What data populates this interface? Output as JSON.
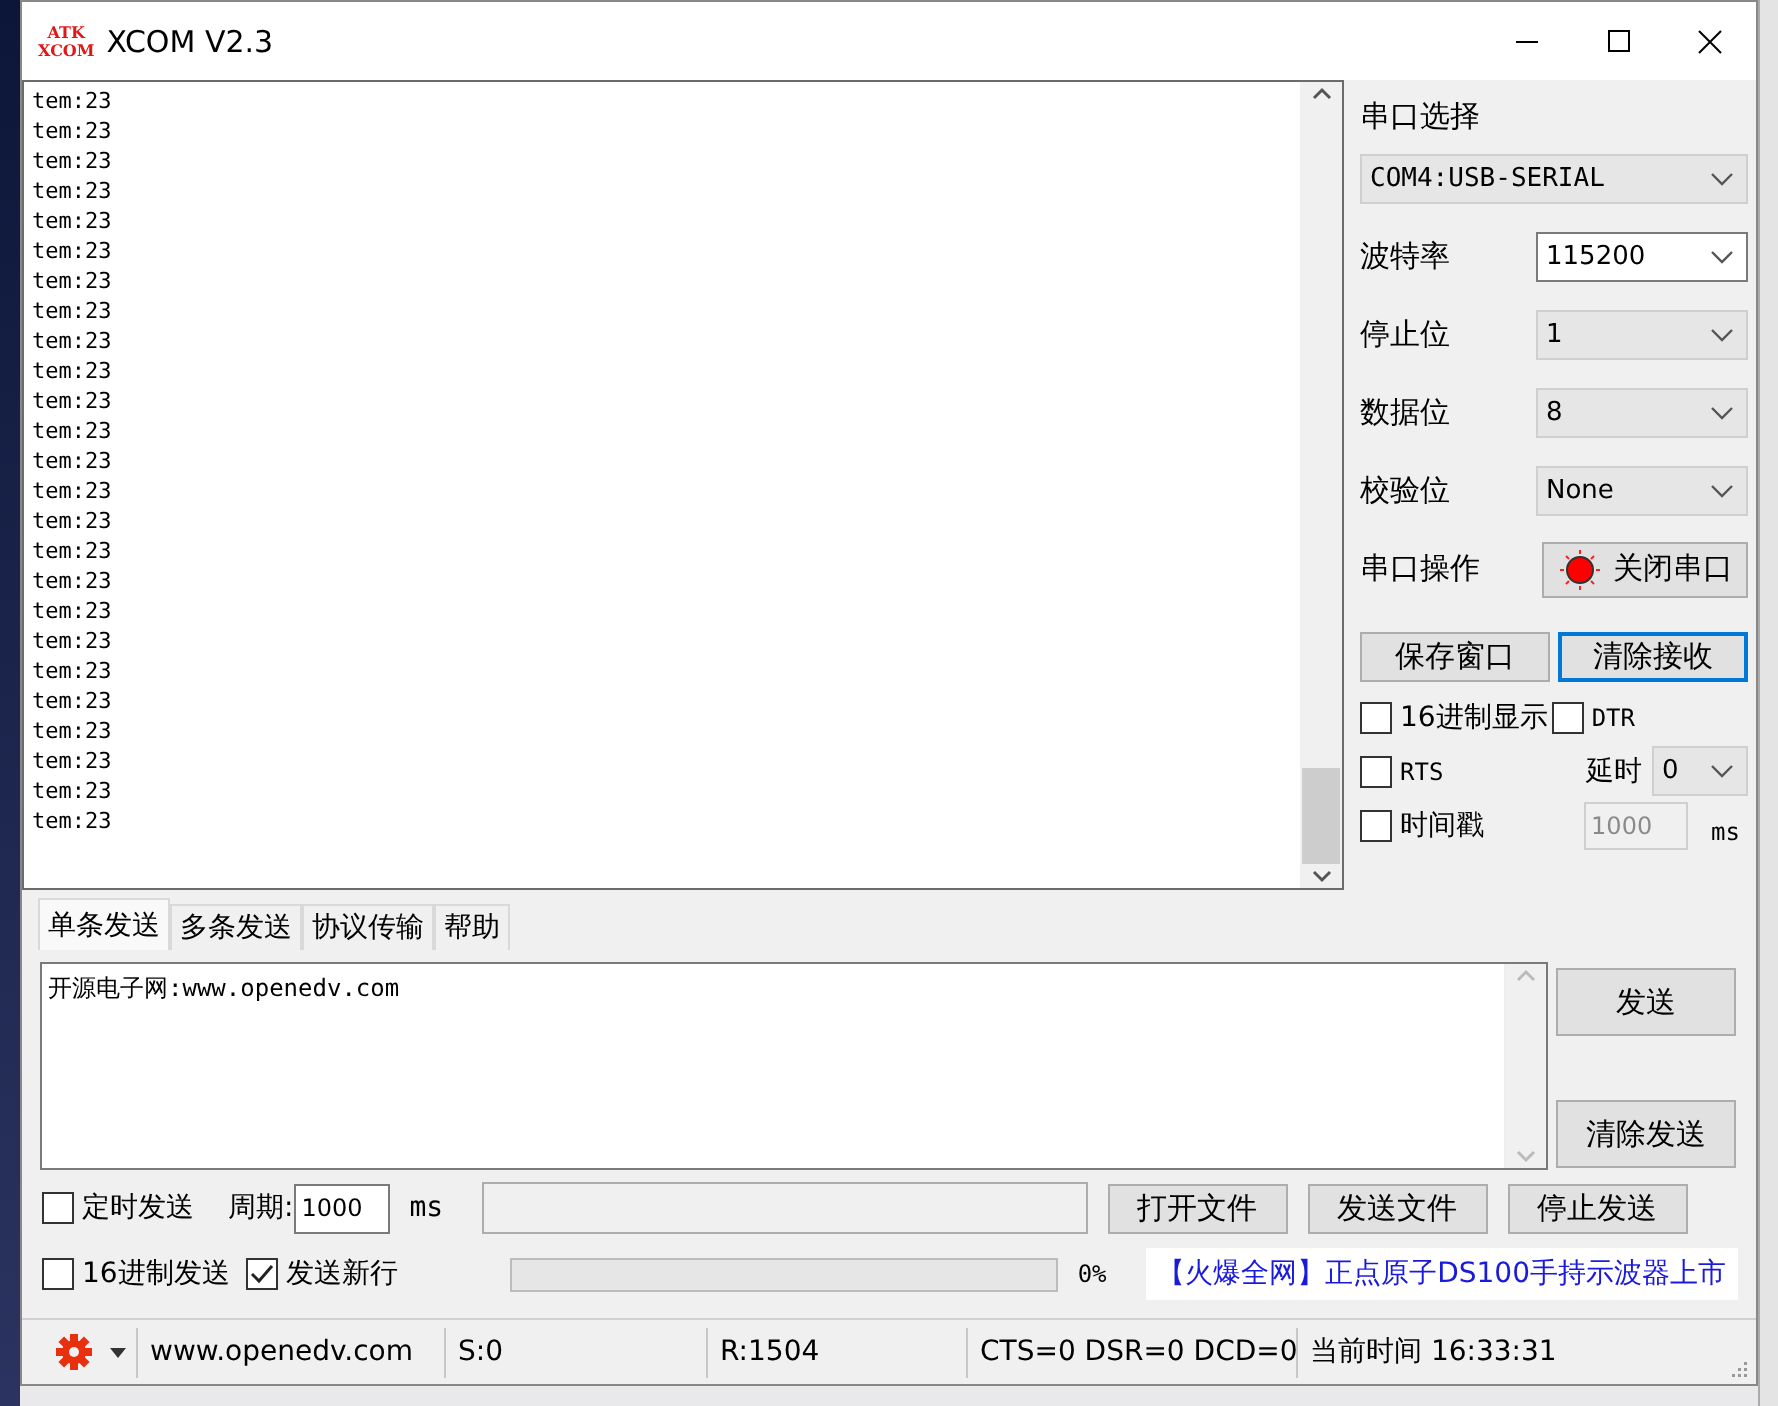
{
  "window": {
    "logo": [
      "ATK",
      "XCOM"
    ],
    "title": "XCOM V2.3"
  },
  "receive": {
    "lines": [
      "tem:23",
      "tem:23",
      "tem:23",
      "tem:23",
      "tem:23",
      "tem:23",
      "tem:23",
      "tem:23",
      "tem:23",
      "tem:23",
      "tem:23",
      "tem:23",
      "tem:23",
      "tem:23",
      "tem:23",
      "tem:23",
      "tem:23",
      "tem:23",
      "tem:23",
      "tem:23",
      "tem:23",
      "tem:23",
      "tem:23",
      "tem:23",
      "tem:23"
    ]
  },
  "port_panel": {
    "title": "串口选择",
    "port": {
      "value": "COM4:USB-SERIAL",
      "disabled": true
    },
    "settings": [
      {
        "label": "波特率",
        "value": "115200",
        "disabled": false
      },
      {
        "label": "停止位",
        "value": "1",
        "disabled": true
      },
      {
        "label": "数据位",
        "value": "8",
        "disabled": true
      },
      {
        "label": "校验位",
        "value": "None",
        "disabled": true
      }
    ],
    "operation": {
      "label": "串口操作",
      "button": "关闭串口",
      "open": true
    },
    "buttons": [
      {
        "label": "保存窗口",
        "selected": false
      },
      {
        "label": "清除接收",
        "selected": true
      }
    ],
    "hex_display": {
      "label": "16进制显示",
      "checked": false
    },
    "dtr": {
      "label": "DTR",
      "checked": false
    },
    "rts": {
      "label": "RTS",
      "checked": false
    },
    "delay": {
      "label": "延时",
      "value": "0"
    },
    "timestamp": {
      "label": "时间戳",
      "checked": false,
      "interval": "1000",
      "unit": "ms"
    }
  },
  "tabs": [
    {
      "label": "单条发送",
      "selected": true
    },
    {
      "label": "多条发送",
      "selected": false
    },
    {
      "label": "协议传输",
      "selected": false
    },
    {
      "label": "帮助",
      "selected": false
    }
  ],
  "send": {
    "text": "开源电子网:www.openedv.com",
    "buttons": [
      "发送",
      "清除发送"
    ]
  },
  "timed_send": {
    "label": "定时发送",
    "checked": false,
    "period_label": "周期:",
    "period": "1000",
    "unit": "ms"
  },
  "hex_send": {
    "label": "16进制发送",
    "checked": false
  },
  "newline": {
    "label": "发送新行",
    "checked": true
  },
  "file_buttons": [
    "打开文件",
    "发送文件",
    "停止发送"
  ],
  "progress": {
    "level": 0,
    "reading": "0%"
  },
  "ad": "【火爆全网】正点原子DS100手持示波器上市",
  "status_bar": {
    "url": "www.openedv.com",
    "sent": "S:0",
    "received": "R:1504",
    "lines": "CTS=0 DSR=0 DCD=0",
    "time": "当前时间 16:33:31"
  }
}
